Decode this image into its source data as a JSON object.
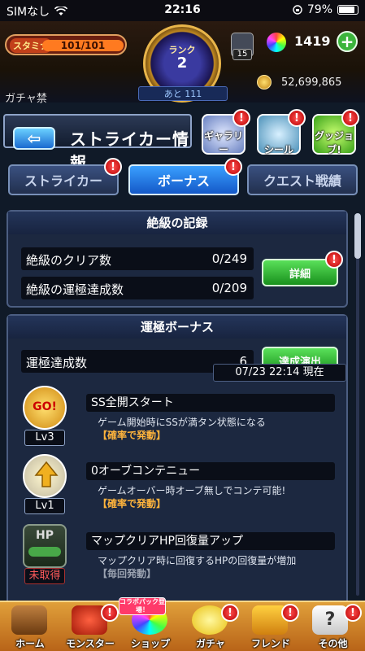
{
  "status_bar": {
    "carrier": "SIMなし",
    "time": "22:16",
    "battery": "79%",
    "battery_level": 0.79
  },
  "header": {
    "stamina_label": "スタミナ",
    "stamina_value": "101/101",
    "rank_label": "ランク",
    "rank_value": "2",
    "gem_count": "15",
    "orb_count": "1419",
    "add_label": "+",
    "gacha_ban": "ガチャ禁",
    "next_rank": "あと 111",
    "coin_count": "52,699,865"
  },
  "title_bar": {
    "back_label": "⇦",
    "title": "ストライカー情報",
    "icons": [
      {
        "label": "ギャラリー",
        "badge": "!"
      },
      {
        "label": "シール",
        "badge": "!"
      },
      {
        "label": "グッジョブ!",
        "badge": "!"
      }
    ]
  },
  "tabs": [
    {
      "label": "ストライカー",
      "active": false,
      "badge": "!"
    },
    {
      "label": "ボーナス",
      "active": true,
      "badge": "!"
    },
    {
      "label": "クエスト戦績",
      "active": false,
      "badge": ""
    }
  ],
  "records": {
    "heading": "絶級の記録",
    "rows": [
      {
        "label": "絶級のクリア数",
        "value": "0/249"
      },
      {
        "label": "絶級の運極達成数",
        "value": "0/209"
      }
    ],
    "detail_button": "詳細",
    "detail_badge": "!"
  },
  "unkyoku": {
    "heading": "運極ボーナス",
    "count_label": "運極達成数",
    "count_value": "6",
    "achievement_button": "達成演出",
    "bonuses": [
      {
        "name": "SS全開スタート",
        "desc": "ゲーム開始時にSSが満タン状態になる",
        "condition": "【確率で発動】",
        "level": "Lv3",
        "icon": "go-icon",
        "icon_text": "GO!"
      },
      {
        "name": "0オーブコンテニュー",
        "desc": "ゲームオーバー時オーブ無しでコンテ可能!",
        "condition": "【確率で発動】",
        "level": "Lv1",
        "icon": "winged-arrow-icon",
        "icon_text": ""
      },
      {
        "name": "マップクリアHP回復量アップ",
        "desc": "マップクリア時に回復するHPの回復量が増加",
        "condition": "【毎回発動】",
        "level": "未取得",
        "icon": "hp-icon",
        "icon_text": "HP"
      }
    ],
    "timestamp": "07/23 22:14 現在"
  },
  "bottom_nav": {
    "items": [
      {
        "label": "ホーム",
        "badge": ""
      },
      {
        "label": "モンスター",
        "badge": "!"
      },
      {
        "label": "ショップ",
        "badge": ""
      },
      {
        "label": "ガチャ",
        "badge": "!"
      },
      {
        "label": "フレンド",
        "badge": "!"
      },
      {
        "label": "その他",
        "badge": "!"
      }
    ],
    "collab_tag": "コラボパック登場！"
  },
  "colors": {
    "accent_blue": "#1458c8",
    "green_button": "#18901c",
    "badge_red": "#b80000",
    "nav_orange": "#e0a03a",
    "condition_orange": "#ffb43c"
  }
}
